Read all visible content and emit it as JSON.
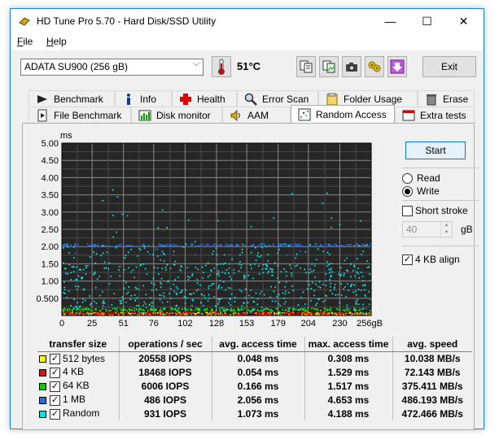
{
  "window": {
    "title": "HD Tune Pro 5.70 - Hard Disk/SSD Utility",
    "minimize": "—",
    "maximize": "☐",
    "close": "✕"
  },
  "menu": [
    {
      "label": "File",
      "accel": "F",
      "rest": "ile"
    },
    {
      "label": "Help",
      "accel": "H",
      "rest": "elp"
    }
  ],
  "toolbar": {
    "drive": "ADATA SU900 (256 gB)",
    "temperature": "51°C",
    "exit_label": "Exit",
    "icons": [
      "copy-info-icon",
      "copy-screenshot-icon",
      "camera-icon",
      "options-icon",
      "save-icon"
    ]
  },
  "tabs": {
    "row1": [
      "Benchmark",
      "Info",
      "Health",
      "Error Scan",
      "Folder Usage",
      "Erase"
    ],
    "row2": [
      "File Benchmark",
      "Disk monitor",
      "AAM",
      "Random Access",
      "Extra tests"
    ],
    "active": "Random Access"
  },
  "controls": {
    "start_label": "Start",
    "read_label": "Read",
    "write_label": "Write",
    "mode_selected": "Write",
    "short_stroke_label": "Short stroke",
    "short_stroke_checked": false,
    "short_stroke_value": "40",
    "short_stroke_unit": "gB",
    "align_label": "4 KB align",
    "align_checked": true
  },
  "chart_data": {
    "type": "scatter",
    "ylabel": "ms",
    "yticks": [
      "5.00",
      "4.50",
      "4.00",
      "3.50",
      "3.00",
      "2.50",
      "2.00",
      "1.50",
      "1.00",
      "0.500"
    ],
    "ylim": [
      0,
      5
    ],
    "xticks": [
      "0",
      "25",
      "51",
      "76",
      "102",
      "128",
      "153",
      "179",
      "204",
      "230",
      "256gB"
    ],
    "xlim": [
      0,
      256
    ],
    "background": "#262626",
    "grid": true,
    "series": [
      {
        "name": "512 bytes",
        "color": "#ffff00",
        "level_ms": 0.048
      },
      {
        "name": "4 KB",
        "color": "#ff0000",
        "level_ms": 0.054
      },
      {
        "name": "64 KB",
        "color": "#00ff00",
        "level_ms": 0.166
      },
      {
        "name": "1 MB",
        "color": "#1e78ff",
        "level_ms": 2.056
      },
      {
        "name": "Random",
        "color": "#00ffff",
        "level_ms": 1.073
      }
    ]
  },
  "results": {
    "headers": [
      "transfer size",
      "operations / sec",
      "avg. access time",
      "max. access time",
      "avg. speed"
    ],
    "rows": [
      {
        "label": "512 bytes",
        "color": "#ffff00",
        "ops": "20558 IOPS",
        "avg": "0.048 ms",
        "max": "0.308 ms",
        "speed": "10.038 MB/s"
      },
      {
        "label": "4 KB",
        "color": "#ff0000",
        "ops": "18468 IOPS",
        "avg": "0.054 ms",
        "max": "1.529 ms",
        "speed": "72.143 MB/s"
      },
      {
        "label": "64 KB",
        "color": "#00cc00",
        "ops": "6006 IOPS",
        "avg": "0.166 ms",
        "max": "1.517 ms",
        "speed": "375.411 MB/s"
      },
      {
        "label": "1 MB",
        "color": "#1e6fe0",
        "ops": "486 IOPS",
        "avg": "2.056 ms",
        "max": "4.653 ms",
        "speed": "486.193 MB/s"
      },
      {
        "label": "Random",
        "color": "#00e5e5",
        "ops": "931 IOPS",
        "avg": "1.073 ms",
        "max": "4.188 ms",
        "speed": "472.466 MB/s"
      }
    ]
  }
}
